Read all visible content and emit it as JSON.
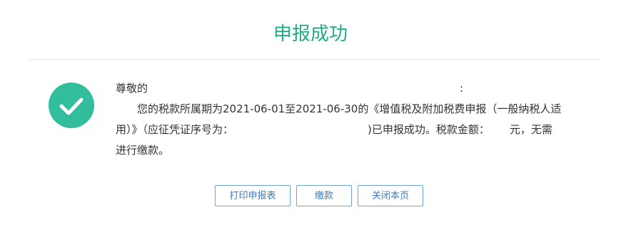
{
  "page": {
    "title": "申报成功"
  },
  "message": {
    "greeting_prefix": "尊敬的",
    "greeting_suffix": ":",
    "line2": "您的税款所属期为2021-06-01至2021-06-30的《增值税及附加税费申报（一般纳税人适",
    "line3_prefix": "用）》（应征凭证序号为：",
    "line3_middle": ")已申报成功。税款金额：",
    "line3_suffix": "元，无需",
    "line4": "进行缴款。"
  },
  "actions": {
    "print_label": "打印申报表",
    "pay_label": "缴款",
    "close_label": "关闭本页"
  },
  "colors": {
    "title": "#22aa8a",
    "success_icon": "#32bd9d",
    "button_border": "#6fa5d2",
    "button_text": "#3b7cc4"
  },
  "icons": {
    "success": "check-circle-icon"
  }
}
